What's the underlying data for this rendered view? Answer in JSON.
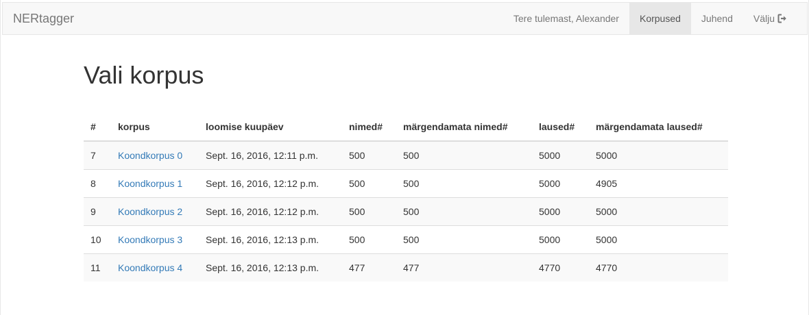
{
  "navbar": {
    "brand": "NERtagger",
    "welcome": "Tere tulemast, Alexander",
    "items": [
      {
        "label": "Korpused",
        "active": true
      },
      {
        "label": "Juhend",
        "active": false
      },
      {
        "label": "Välju",
        "active": false,
        "icon": "sign-out-icon"
      }
    ]
  },
  "main": {
    "title": "Vali korpus",
    "table": {
      "headers": [
        "#",
        "korpus",
        "loomise kuupäev",
        "nimed#",
        "märgendamata nimed#",
        "laused#",
        "märgendamata laused#"
      ],
      "rows": [
        [
          "7",
          "Koondkorpus 0",
          "Sept. 16, 2016, 12:11 p.m.",
          "500",
          "500",
          "5000",
          "5000"
        ],
        [
          "8",
          "Koondkorpus 1",
          "Sept. 16, 2016, 12:12 p.m.",
          "500",
          "500",
          "5000",
          "4905"
        ],
        [
          "9",
          "Koondkorpus 2",
          "Sept. 16, 2016, 12:12 p.m.",
          "500",
          "500",
          "5000",
          "5000"
        ],
        [
          "10",
          "Koondkorpus 3",
          "Sept. 16, 2016, 12:13 p.m.",
          "500",
          "500",
          "5000",
          "5000"
        ],
        [
          "11",
          "Koondkorpus 4",
          "Sept. 16, 2016, 12:13 p.m.",
          "477",
          "477",
          "4770",
          "4770"
        ]
      ]
    }
  },
  "colors": {
    "link": "#337ab7",
    "navbar_bg": "#f8f8f8",
    "active_bg": "#e7e7e7",
    "stripe": "#f9f9f9"
  }
}
